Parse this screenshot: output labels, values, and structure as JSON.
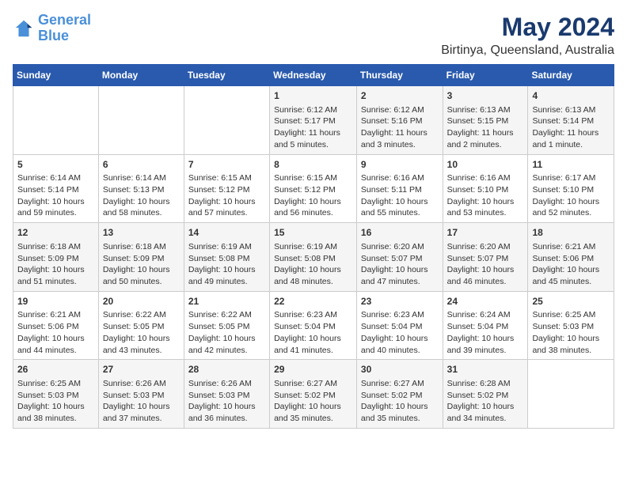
{
  "header": {
    "logo_line1": "General",
    "logo_line2": "Blue",
    "title": "May 2024",
    "subtitle": "Birtinya, Queensland, Australia"
  },
  "days_of_week": [
    "Sunday",
    "Monday",
    "Tuesday",
    "Wednesday",
    "Thursday",
    "Friday",
    "Saturday"
  ],
  "weeks": [
    {
      "cells": [
        {
          "day": "",
          "content": ""
        },
        {
          "day": "",
          "content": ""
        },
        {
          "day": "",
          "content": ""
        },
        {
          "day": "1",
          "content": "Sunrise: 6:12 AM\nSunset: 5:17 PM\nDaylight: 11 hours\nand 5 minutes."
        },
        {
          "day": "2",
          "content": "Sunrise: 6:12 AM\nSunset: 5:16 PM\nDaylight: 11 hours\nand 3 minutes."
        },
        {
          "day": "3",
          "content": "Sunrise: 6:13 AM\nSunset: 5:15 PM\nDaylight: 11 hours\nand 2 minutes."
        },
        {
          "day": "4",
          "content": "Sunrise: 6:13 AM\nSunset: 5:14 PM\nDaylight: 11 hours\nand 1 minute."
        }
      ]
    },
    {
      "cells": [
        {
          "day": "5",
          "content": "Sunrise: 6:14 AM\nSunset: 5:14 PM\nDaylight: 10 hours\nand 59 minutes."
        },
        {
          "day": "6",
          "content": "Sunrise: 6:14 AM\nSunset: 5:13 PM\nDaylight: 10 hours\nand 58 minutes."
        },
        {
          "day": "7",
          "content": "Sunrise: 6:15 AM\nSunset: 5:12 PM\nDaylight: 10 hours\nand 57 minutes."
        },
        {
          "day": "8",
          "content": "Sunrise: 6:15 AM\nSunset: 5:12 PM\nDaylight: 10 hours\nand 56 minutes."
        },
        {
          "day": "9",
          "content": "Sunrise: 6:16 AM\nSunset: 5:11 PM\nDaylight: 10 hours\nand 55 minutes."
        },
        {
          "day": "10",
          "content": "Sunrise: 6:16 AM\nSunset: 5:10 PM\nDaylight: 10 hours\nand 53 minutes."
        },
        {
          "day": "11",
          "content": "Sunrise: 6:17 AM\nSunset: 5:10 PM\nDaylight: 10 hours\nand 52 minutes."
        }
      ]
    },
    {
      "cells": [
        {
          "day": "12",
          "content": "Sunrise: 6:18 AM\nSunset: 5:09 PM\nDaylight: 10 hours\nand 51 minutes."
        },
        {
          "day": "13",
          "content": "Sunrise: 6:18 AM\nSunset: 5:09 PM\nDaylight: 10 hours\nand 50 minutes."
        },
        {
          "day": "14",
          "content": "Sunrise: 6:19 AM\nSunset: 5:08 PM\nDaylight: 10 hours\nand 49 minutes."
        },
        {
          "day": "15",
          "content": "Sunrise: 6:19 AM\nSunset: 5:08 PM\nDaylight: 10 hours\nand 48 minutes."
        },
        {
          "day": "16",
          "content": "Sunrise: 6:20 AM\nSunset: 5:07 PM\nDaylight: 10 hours\nand 47 minutes."
        },
        {
          "day": "17",
          "content": "Sunrise: 6:20 AM\nSunset: 5:07 PM\nDaylight: 10 hours\nand 46 minutes."
        },
        {
          "day": "18",
          "content": "Sunrise: 6:21 AM\nSunset: 5:06 PM\nDaylight: 10 hours\nand 45 minutes."
        }
      ]
    },
    {
      "cells": [
        {
          "day": "19",
          "content": "Sunrise: 6:21 AM\nSunset: 5:06 PM\nDaylight: 10 hours\nand 44 minutes."
        },
        {
          "day": "20",
          "content": "Sunrise: 6:22 AM\nSunset: 5:05 PM\nDaylight: 10 hours\nand 43 minutes."
        },
        {
          "day": "21",
          "content": "Sunrise: 6:22 AM\nSunset: 5:05 PM\nDaylight: 10 hours\nand 42 minutes."
        },
        {
          "day": "22",
          "content": "Sunrise: 6:23 AM\nSunset: 5:04 PM\nDaylight: 10 hours\nand 41 minutes."
        },
        {
          "day": "23",
          "content": "Sunrise: 6:23 AM\nSunset: 5:04 PM\nDaylight: 10 hours\nand 40 minutes."
        },
        {
          "day": "24",
          "content": "Sunrise: 6:24 AM\nSunset: 5:04 PM\nDaylight: 10 hours\nand 39 minutes."
        },
        {
          "day": "25",
          "content": "Sunrise: 6:25 AM\nSunset: 5:03 PM\nDaylight: 10 hours\nand 38 minutes."
        }
      ]
    },
    {
      "cells": [
        {
          "day": "26",
          "content": "Sunrise: 6:25 AM\nSunset: 5:03 PM\nDaylight: 10 hours\nand 38 minutes."
        },
        {
          "day": "27",
          "content": "Sunrise: 6:26 AM\nSunset: 5:03 PM\nDaylight: 10 hours\nand 37 minutes."
        },
        {
          "day": "28",
          "content": "Sunrise: 6:26 AM\nSunset: 5:03 PM\nDaylight: 10 hours\nand 36 minutes."
        },
        {
          "day": "29",
          "content": "Sunrise: 6:27 AM\nSunset: 5:02 PM\nDaylight: 10 hours\nand 35 minutes."
        },
        {
          "day": "30",
          "content": "Sunrise: 6:27 AM\nSunset: 5:02 PM\nDaylight: 10 hours\nand 35 minutes."
        },
        {
          "day": "31",
          "content": "Sunrise: 6:28 AM\nSunset: 5:02 PM\nDaylight: 10 hours\nand 34 minutes."
        },
        {
          "day": "",
          "content": ""
        }
      ]
    }
  ]
}
